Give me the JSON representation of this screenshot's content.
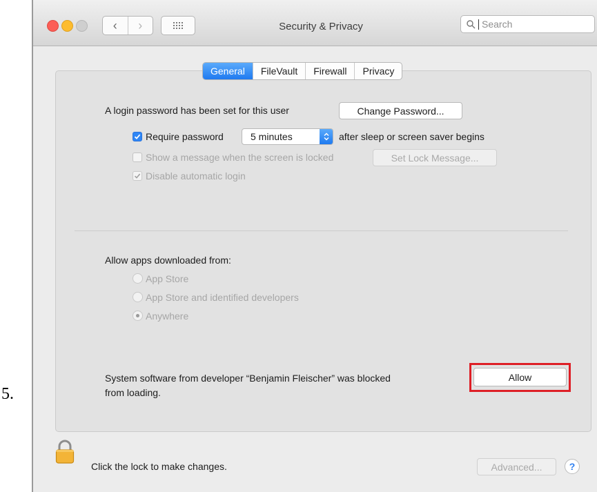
{
  "step_label": "5.",
  "window": {
    "title": "Security & Privacy",
    "search_placeholder": "Search"
  },
  "tabs": [
    {
      "label": "General",
      "active": true
    },
    {
      "label": "FileVault",
      "active": false
    },
    {
      "label": "Firewall",
      "active": false
    },
    {
      "label": "Privacy",
      "active": false
    }
  ],
  "general": {
    "login_text": "A login password has been set for this user",
    "change_password_button": "Change Password...",
    "require_password": {
      "label": "Require password",
      "checked": true
    },
    "require_interval": "5 minutes",
    "after_sleep_text": "after sleep or screen saver begins",
    "show_message": {
      "label": "Show a message when the screen is locked",
      "checked": false
    },
    "set_lock_message_button": "Set Lock Message...",
    "disable_auto_login": {
      "label": "Disable automatic login",
      "checked": true
    }
  },
  "downloads": {
    "heading": "Allow apps downloaded from:",
    "options": [
      {
        "label": "App Store",
        "selected": false
      },
      {
        "label": "App Store and identified developers",
        "selected": false
      },
      {
        "label": "Anywhere",
        "selected": true
      }
    ]
  },
  "blocked": {
    "line1": "System software from developer “Benjamin Fleischer” was blocked",
    "line2": "from loading.",
    "allow_button": "Allow",
    "highlight_color": "#de1f26"
  },
  "footer": {
    "lock_text": "Click the lock to make changes.",
    "advanced_button": "Advanced...",
    "help_button": "?"
  },
  "colors": {
    "accent": "#2f86f5",
    "traffic_red": "#fc5e57",
    "traffic_yellow": "#fdbc2e"
  }
}
